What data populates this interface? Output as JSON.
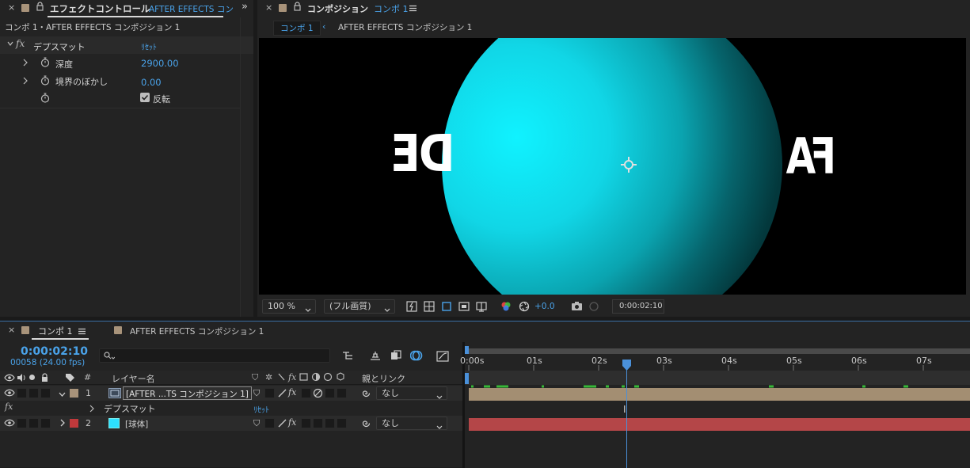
{
  "effect_panel": {
    "tab_title": "エフェクトコントロール",
    "tab_subtitle": "AFTER EFFECTS コン",
    "breadcrumb": "コンポ 1・AFTER EFFECTS コンポジション 1",
    "effect_name": "デプスマット",
    "reset_label": "ﾘｾｯﾄ",
    "props": [
      {
        "label": "深度",
        "value": "2900.00"
      },
      {
        "label": "境界のぼかし",
        "value": "0.00"
      }
    ],
    "checkbox_label": "反転"
  },
  "comp_panel": {
    "tab_title": "コンポジション",
    "tab_comp": "コンポ 1",
    "flow_current": "コンポ 1",
    "flow_next": "AFTER EFFECTS コンポジション 1",
    "viewer_text_left": "DE",
    "viewer_text_right": "FA",
    "footer": {
      "zoom": "100 %",
      "quality": "(フル画質)",
      "exposure": "+0.0",
      "timecode": "0:00:02:10"
    }
  },
  "timeline": {
    "tab_label": "コンポ 1",
    "other_tab": "AFTER EFFECTS コンポジション 1",
    "timecode": "0:00:02:10",
    "frame_info": "00058 (24.00 fps)",
    "search_placeholder": "",
    "headers": {
      "num": "#",
      "layer_name": "レイヤー名",
      "parent": "親とリンク"
    },
    "ruler": [
      "0:00s",
      "01s",
      "02s",
      "03s",
      "04s",
      "05s",
      "06s",
      "07s"
    ],
    "layers": [
      {
        "num": "1",
        "name": "[AFTER ...TS コンポジション 1]",
        "parent": "なし",
        "label_color": "#a8937a",
        "bar_color": "#a38e72"
      },
      {
        "num": "2",
        "name": "[球体]",
        "parent": "なし",
        "label_color": "#c0393b",
        "bar_color": "#b44648"
      }
    ],
    "effect_row": {
      "name": "デプスマット",
      "reset": "ﾘｾｯﾄ"
    }
  }
}
